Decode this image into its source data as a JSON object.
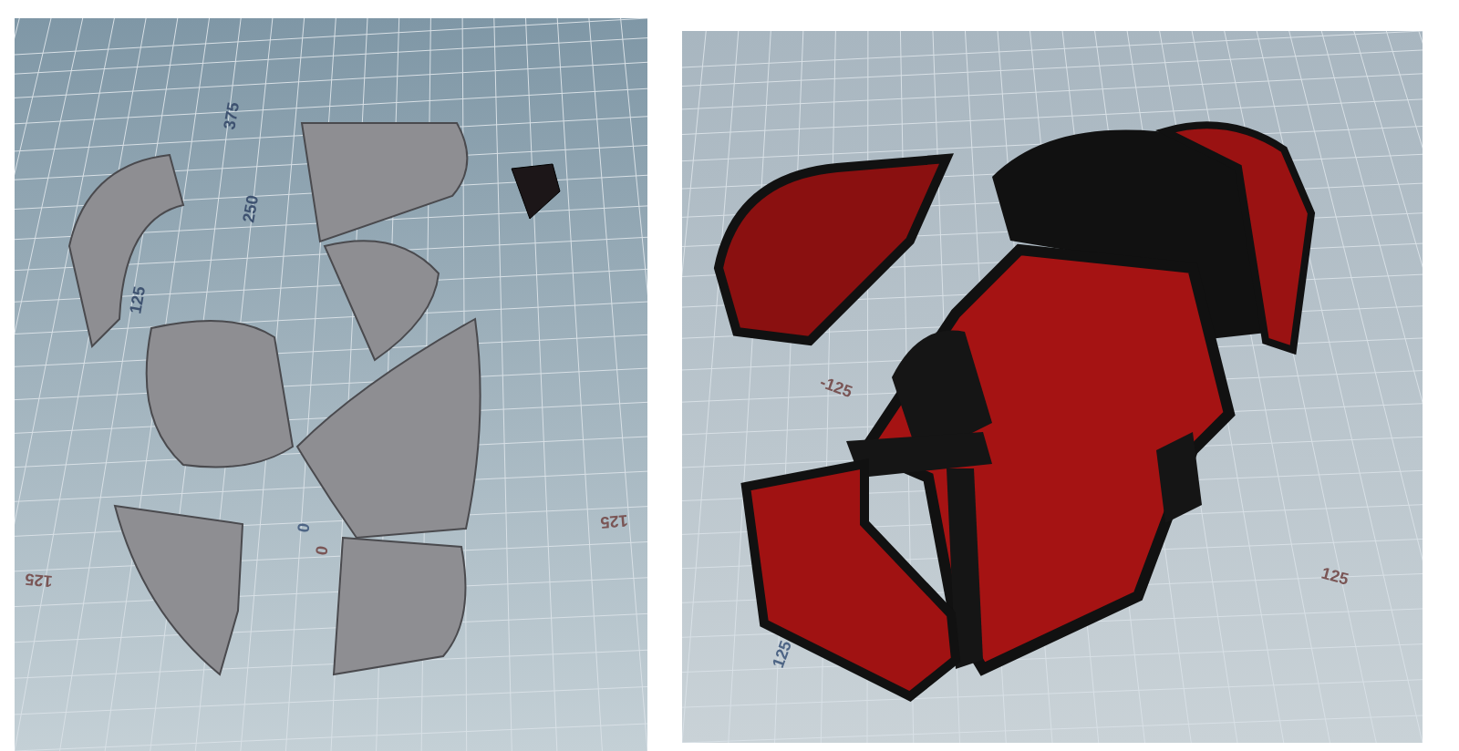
{
  "viewports": [
    {
      "kind": "exploded-parts",
      "axis_labels": [
        {
          "text": "375",
          "color": "#3e5270"
        },
        {
          "text": "250",
          "color": "#3e5270"
        },
        {
          "text": "125",
          "color": "#3e5270"
        },
        {
          "text": "0",
          "color": "#4e6585"
        },
        {
          "text": "0",
          "color": "#7a5555"
        },
        {
          "text": "125",
          "color": "#7a5555"
        },
        {
          "text": "125",
          "color": "#7a5555"
        }
      ]
    },
    {
      "kind": "chest",
      "axis_labels": [
        {
          "text": "-125",
          "color": "#7a5555"
        },
        {
          "text": "125",
          "color": "#7a5555"
        },
        {
          "text": "125",
          "color": "#4e6585"
        }
      ]
    }
  ]
}
